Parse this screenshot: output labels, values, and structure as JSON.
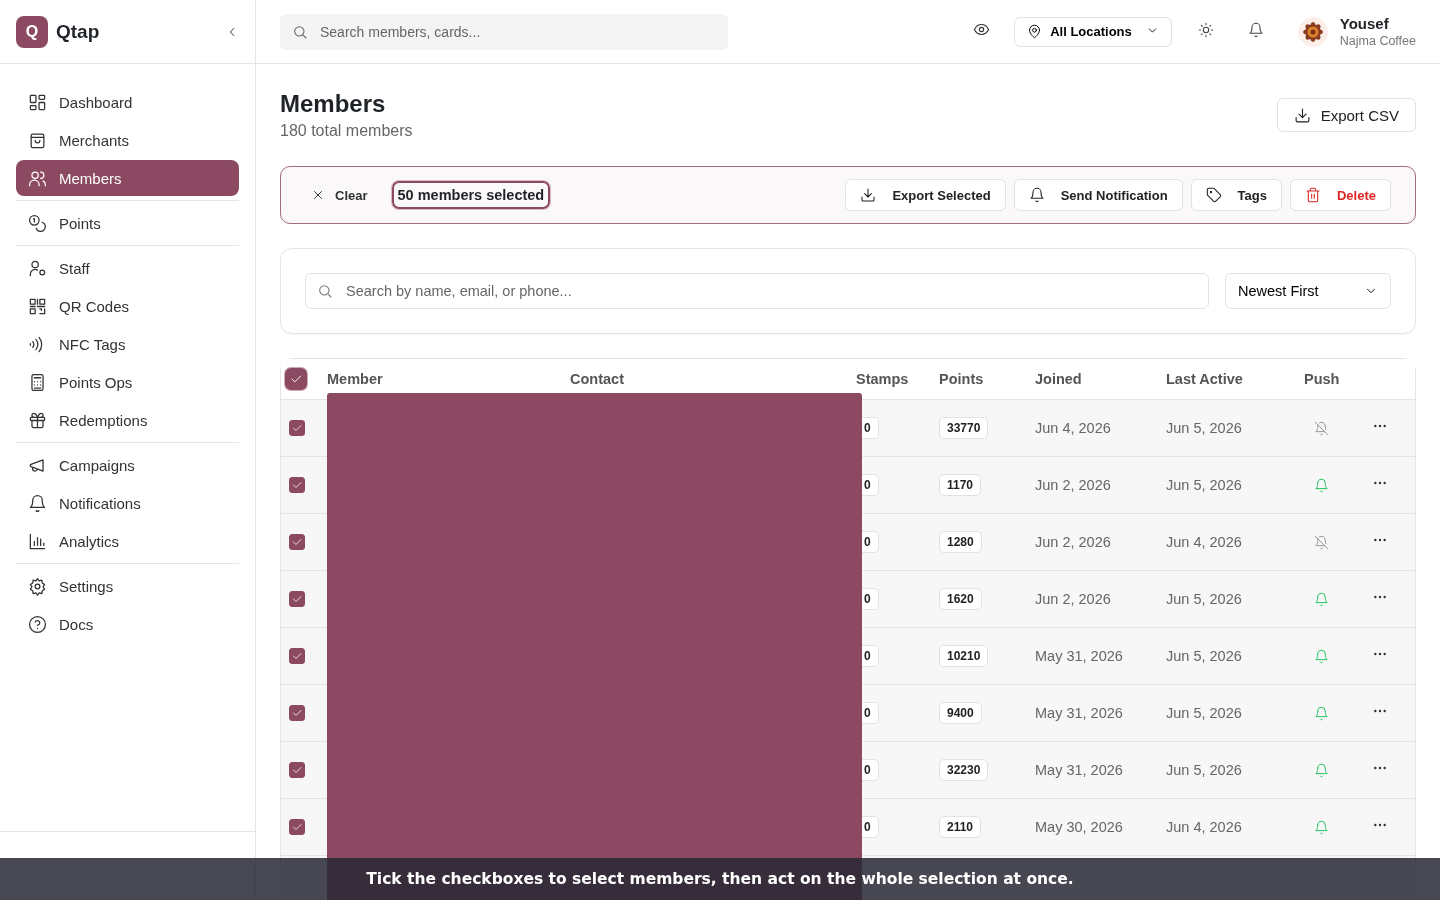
{
  "brand": {
    "initial": "Q",
    "name": "Qtap"
  },
  "sidebar": {
    "groups": [
      [
        {
          "label": "Dashboard",
          "selected": false
        },
        {
          "label": "Merchants",
          "selected": false
        },
        {
          "label": "Members",
          "selected": true
        }
      ],
      [
        {
          "label": "Points",
          "selected": false
        }
      ],
      [
        {
          "label": "Staff",
          "selected": false
        },
        {
          "label": "QR Codes",
          "selected": false
        },
        {
          "label": "NFC Tags",
          "selected": false
        },
        {
          "label": "Points Ops",
          "selected": false
        },
        {
          "label": "Redemptions",
          "selected": false
        }
      ],
      [
        {
          "label": "Campaigns",
          "selected": false
        },
        {
          "label": "Notifications",
          "selected": false
        },
        {
          "label": "Analytics",
          "selected": false
        }
      ],
      [
        {
          "label": "Settings",
          "selected": false
        },
        {
          "label": "Docs",
          "selected": false
        }
      ]
    ]
  },
  "topbar": {
    "search": {
      "placeholder": "Search members, cards..."
    },
    "location": "All Locations",
    "user": {
      "name": "Yousef",
      "business": "Najma Coffee"
    }
  },
  "page": {
    "title": "Members",
    "subtitle": "180 total members",
    "export_button": "Export CSV"
  },
  "selection_bar": {
    "clear": "Clear",
    "count": "50 members selected",
    "actions": [
      {
        "label": "Export Selected",
        "kind": "export"
      },
      {
        "label": "Send Notification",
        "kind": "notify"
      },
      {
        "label": "Tags",
        "kind": "tags"
      },
      {
        "label": "Delete",
        "kind": "delete"
      }
    ]
  },
  "filters": {
    "search": {
      "placeholder": "Search by name, email, or phone..."
    },
    "sort": "Newest First"
  },
  "table": {
    "all_selected": true,
    "columns": [
      "Member",
      "Contact",
      "Stamps",
      "Points",
      "Joined",
      "Last Active",
      "Push"
    ],
    "rows": [
      {
        "selected": true,
        "stamps": "0",
        "points": "33770",
        "joined": "Jun 4, 2026",
        "last_active": "Jun 5, 2026",
        "push": false
      },
      {
        "selected": true,
        "stamps": "0",
        "points": "1170",
        "joined": "Jun 2, 2026",
        "last_active": "Jun 5, 2026",
        "push": true
      },
      {
        "selected": true,
        "stamps": "0",
        "points": "1280",
        "joined": "Jun 2, 2026",
        "last_active": "Jun 4, 2026",
        "push": false
      },
      {
        "selected": true,
        "stamps": "0",
        "points": "1620",
        "joined": "Jun 2, 2026",
        "last_active": "Jun 5, 2026",
        "push": true
      },
      {
        "selected": true,
        "stamps": "0",
        "points": "10210",
        "joined": "May 31, 2026",
        "last_active": "Jun 5, 2026",
        "push": true
      },
      {
        "selected": true,
        "stamps": "0",
        "points": "9400",
        "joined": "May 31, 2026",
        "last_active": "Jun 5, 2026",
        "push": true
      },
      {
        "selected": true,
        "stamps": "0",
        "points": "32230",
        "joined": "May 31, 2026",
        "last_active": "Jun 5, 2026",
        "push": true
      },
      {
        "selected": true,
        "stamps": "0",
        "points": "2110",
        "joined": "May 30, 2026",
        "last_active": "Jun 4, 2026",
        "push": true
      }
    ]
  },
  "hint_banner": "Tick the checkboxes to select members, then act on the whole selection at once."
}
